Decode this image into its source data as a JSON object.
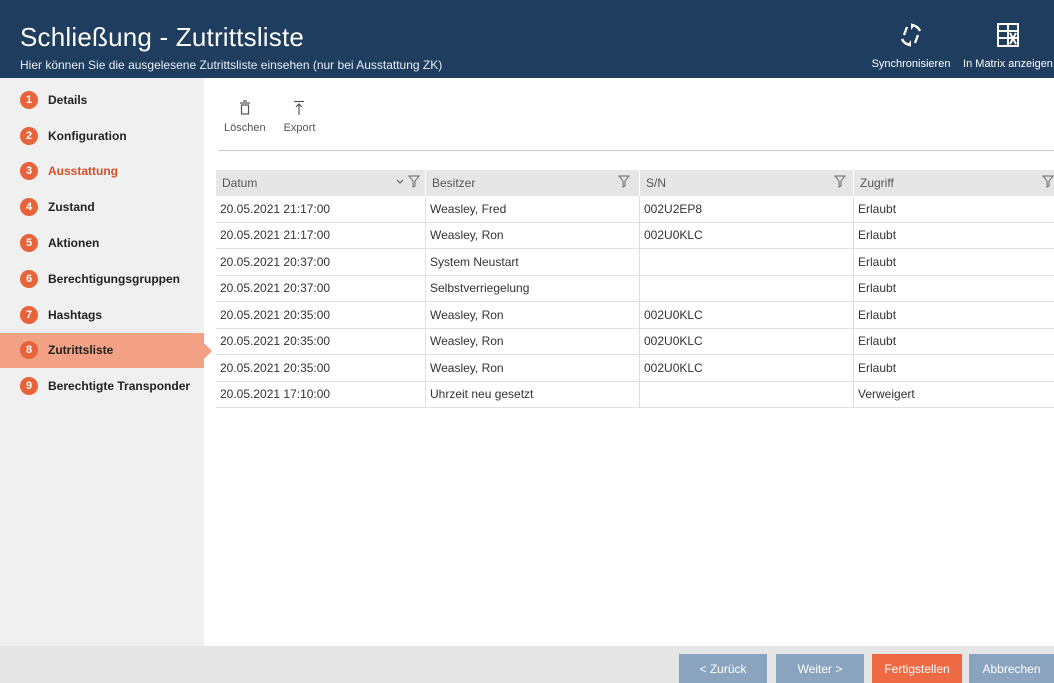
{
  "header": {
    "title": "Schließung - Zutrittsliste",
    "subtitle": "Hier können Sie die ausgelesene Zutrittsliste einsehen (nur bei Ausstattung ZK)",
    "sync_label": "Synchronisieren",
    "matrix_label": "In Matrix anzeigen"
  },
  "sidebar": {
    "items": [
      {
        "num": "1",
        "label": "Details"
      },
      {
        "num": "2",
        "label": "Konfiguration"
      },
      {
        "num": "3",
        "label": "Ausstattung"
      },
      {
        "num": "4",
        "label": "Zustand"
      },
      {
        "num": "5",
        "label": "Aktionen"
      },
      {
        "num": "6",
        "label": "Berechtigungsgruppen"
      },
      {
        "num": "7",
        "label": "Hashtags"
      },
      {
        "num": "8",
        "label": "Zutrittsliste"
      },
      {
        "num": "9",
        "label": "Berechtigte Transponder"
      }
    ]
  },
  "toolbar": {
    "delete_label": "Löschen",
    "export_label": "Export"
  },
  "table": {
    "headers": [
      "Datum",
      "Besitzer",
      "S/N",
      "Zugriff"
    ],
    "rows": [
      [
        "20.05.2021 21:17:00",
        "Weasley, Fred",
        "002U2EP8",
        "Erlaubt"
      ],
      [
        "20.05.2021 21:17:00",
        "Weasley, Ron",
        "002U0KLC",
        "Erlaubt"
      ],
      [
        "20.05.2021 20:37:00",
        "System Neustart",
        "",
        "Erlaubt"
      ],
      [
        "20.05.2021 20:37:00",
        "Selbstverriegelung",
        "",
        "Erlaubt"
      ],
      [
        "20.05.2021 20:35:00",
        "Weasley, Ron",
        "002U0KLC",
        "Erlaubt"
      ],
      [
        "20.05.2021 20:35:00",
        "Weasley, Ron",
        "002U0KLC",
        "Erlaubt"
      ],
      [
        "20.05.2021 20:35:00",
        "Weasley, Ron",
        "002U0KLC",
        "Erlaubt"
      ],
      [
        "20.05.2021 17:10:00",
        "Uhrzeit neu gesetzt",
        "",
        "Verweigert"
      ]
    ]
  },
  "footer": {
    "back_label": "< Zurück",
    "next_label": "Weiter >",
    "finish_label": "Fertigstellen",
    "cancel_label": "Abbrechen"
  }
}
